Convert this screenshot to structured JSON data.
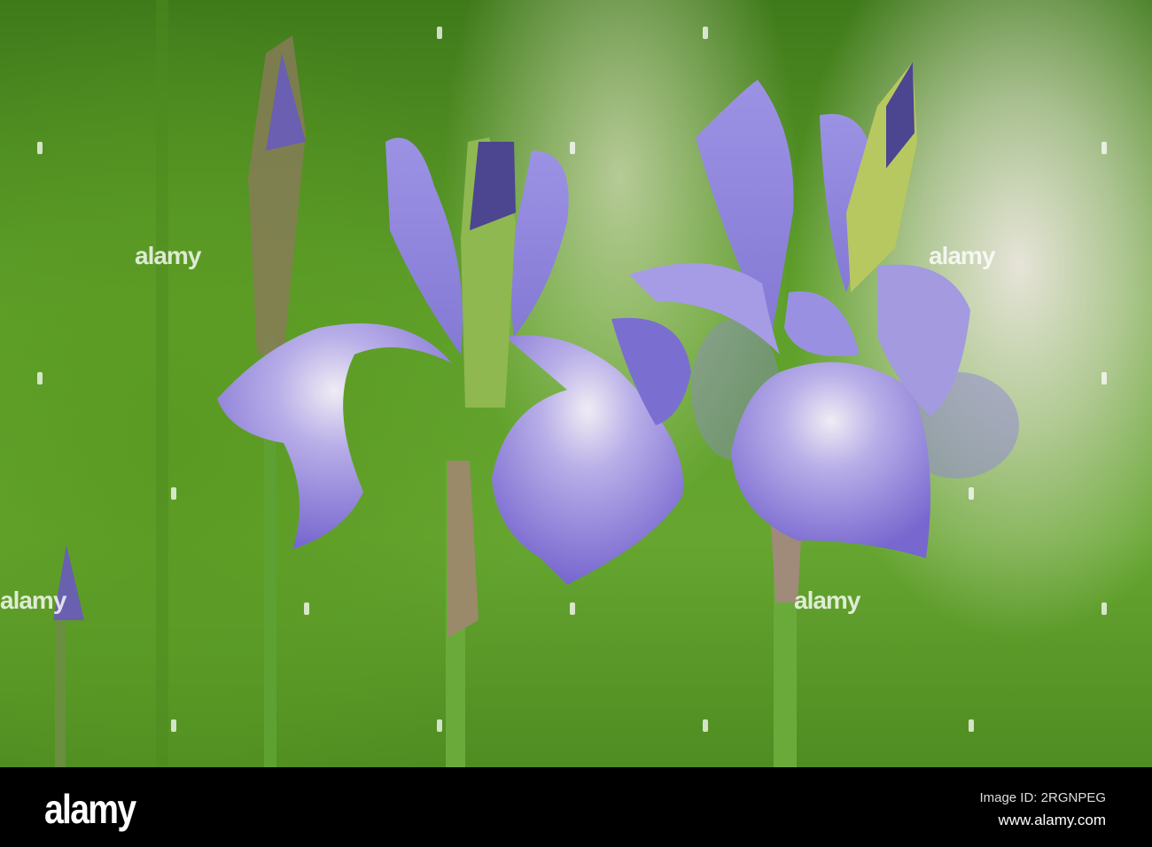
{
  "watermark": {
    "text": "alamy"
  },
  "footer": {
    "logo": "alamy",
    "image_id": "Image ID: 2RGNPEG",
    "website": "www.alamy.com"
  },
  "colors": {
    "petal": "#8a7fd8",
    "foliage": "#5fa02a",
    "background_light": "#e6e4d8"
  }
}
